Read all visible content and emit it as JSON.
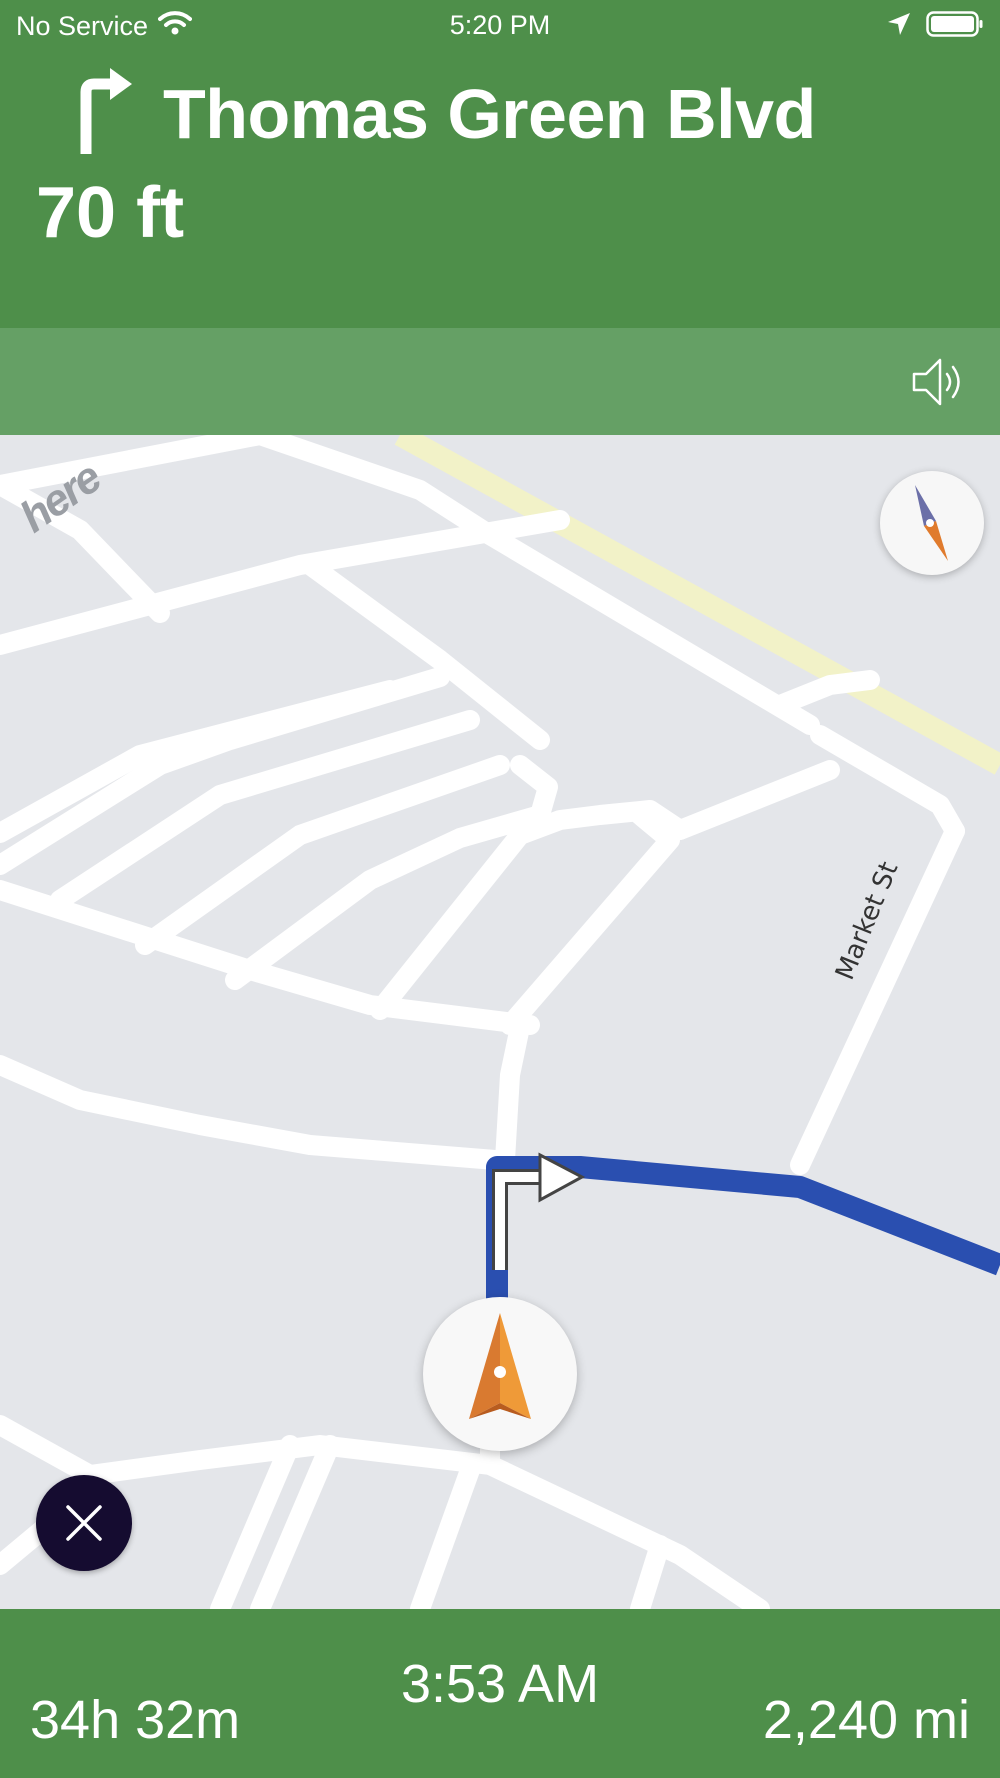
{
  "status_bar": {
    "carrier": "No Service",
    "time": "5:20 PM",
    "icons": [
      "wifi-icon",
      "location-arrow-icon",
      "battery-icon"
    ]
  },
  "maneuver": {
    "icon": "turn-right-arrow-icon",
    "street": "Thomas Green Blvd",
    "distance": "70 ft"
  },
  "audio": {
    "icon": "speaker-icon"
  },
  "map": {
    "provider_logo": "here",
    "street_labels": [
      "Market St"
    ],
    "route_color": "#2a4fb0",
    "compass_icon": "compass-icon",
    "position_icon": "navigation-arrow-icon"
  },
  "controls": {
    "close_icon": "close-icon"
  },
  "trip": {
    "remaining_time": "34h 32m",
    "eta": "3:53 AM",
    "remaining_distance": "2,240 mi"
  },
  "colors": {
    "header_green": "#4e8f4a",
    "subbar_green": "#65a065",
    "close_button": "#150c30",
    "position_orange": "#ef9a38"
  }
}
